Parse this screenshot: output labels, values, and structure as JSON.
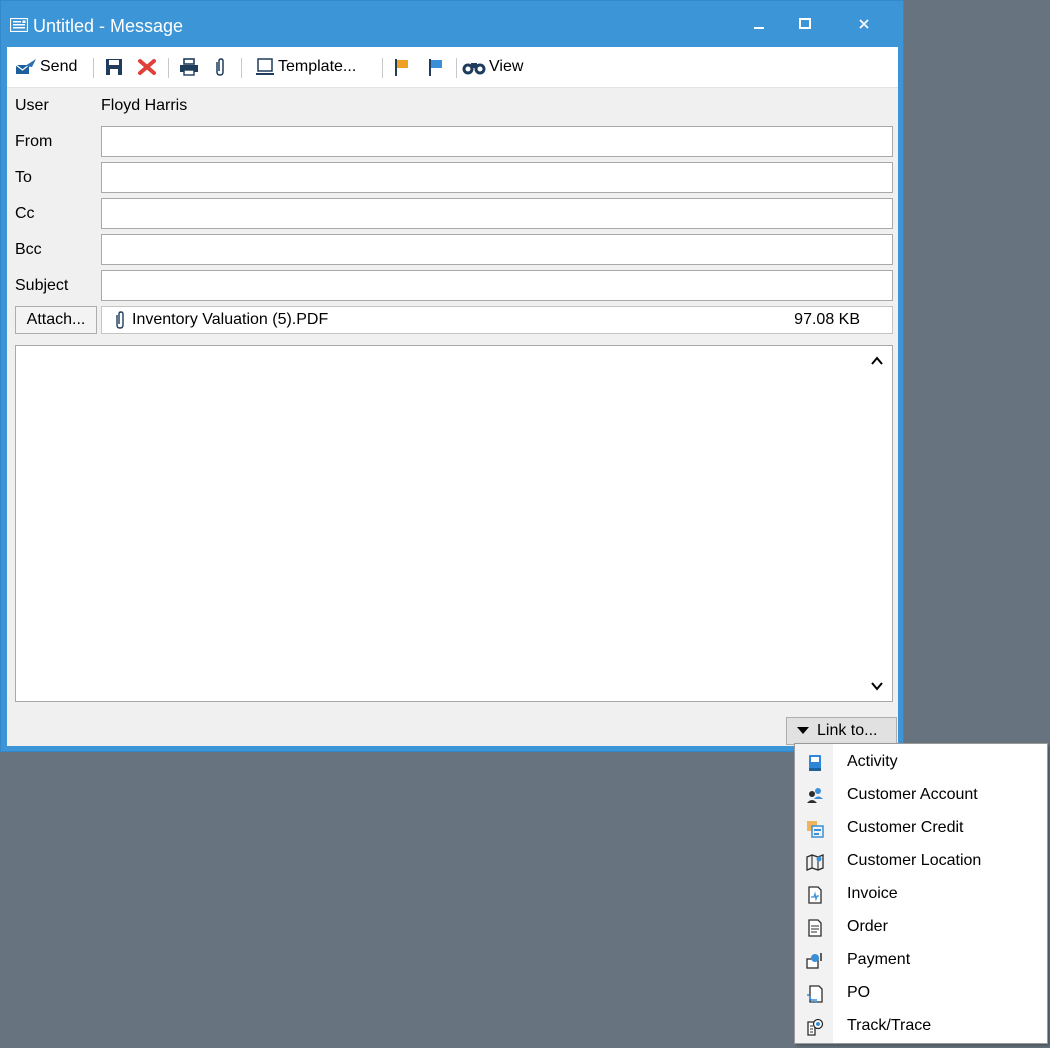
{
  "window": {
    "title": "Untitled - Message",
    "controls": [
      "minimize",
      "maximize",
      "close"
    ]
  },
  "toolbar": {
    "send_label": "Send",
    "template_label": "Template...",
    "view_label": "View",
    "icons": [
      "send-icon",
      "save-icon",
      "delete-icon",
      "print-icon",
      "paperclip-icon",
      "template-icon",
      "orange-flag-icon",
      "blue-flag-icon",
      "binoculars-icon"
    ]
  },
  "form": {
    "user_label": "User",
    "user_value": "Floyd Harris",
    "from_label": "From",
    "from_value": "",
    "to_label": "To",
    "to_value": "",
    "cc_label": "Cc",
    "cc_value": "",
    "bcc_label": "Bcc",
    "bcc_value": "",
    "subject_label": "Subject",
    "subject_value": ""
  },
  "attachment": {
    "button_label": "Attach...",
    "file_name": "Inventory Valuation (5).PDF",
    "file_size": "97.08 KB"
  },
  "body": {
    "text": ""
  },
  "link": {
    "button_label": "Link to...",
    "menu_items": [
      {
        "label": "Activity",
        "icon": "activity-icon"
      },
      {
        "label": "Customer Account",
        "icon": "customer-account-icon"
      },
      {
        "label": "Customer Credit",
        "icon": "customer-credit-icon"
      },
      {
        "label": "Customer Location",
        "icon": "customer-location-icon"
      },
      {
        "label": "Invoice",
        "icon": "invoice-icon"
      },
      {
        "label": "Order",
        "icon": "order-icon"
      },
      {
        "label": "Payment",
        "icon": "payment-icon"
      },
      {
        "label": "PO",
        "icon": "po-icon"
      },
      {
        "label": "Track/Trace",
        "icon": "track-trace-icon"
      }
    ]
  },
  "colors": {
    "titlebar": "#3c95d6",
    "desktop": "#67737e",
    "flag_orange": "#f0a020",
    "flag_blue": "#3a8fd8",
    "delete_red": "#e0403a"
  }
}
